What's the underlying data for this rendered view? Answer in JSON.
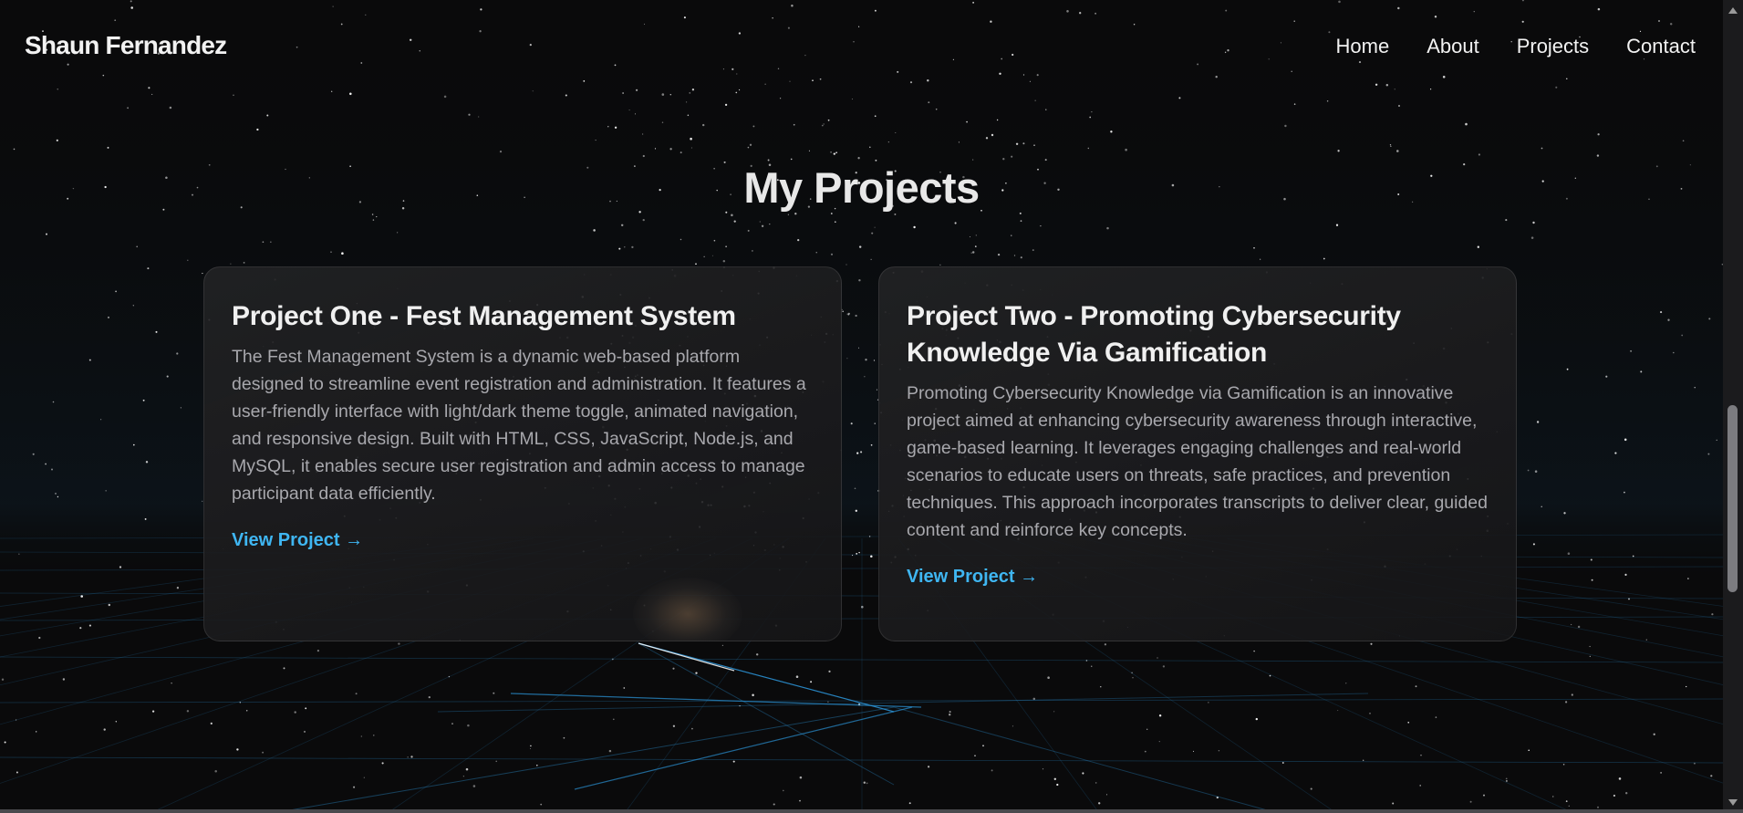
{
  "brand": {
    "name": "Shaun Fernandez"
  },
  "nav": {
    "items": [
      {
        "label": "Home"
      },
      {
        "label": "About"
      },
      {
        "label": "Projects"
      },
      {
        "label": "Contact"
      }
    ]
  },
  "projects": {
    "heading": "My Projects",
    "cards": [
      {
        "title": "Project One - Fest Management System",
        "description": "The Fest Management System is a dynamic web-based platform designed to streamline event registration and administration. It features a user-friendly interface with light/dark theme toggle, animated navigation, and responsive design. Built with HTML, CSS, JavaScript, Node.js, and MySQL, it enables secure user registration and admin access to manage participant data efficiently.",
        "link_label": "View Project →"
      },
      {
        "title": "Project Two - Promoting Cybersecurity Knowledge Via Gamification",
        "description": "Promoting Cybersecurity Knowledge via Gamification is an innovative project aimed at enhancing cybersecurity awareness through interactive, game-based learning. It leverages engaging challenges and real-world scenarios to educate users on threats, safe practices, and prevention techniques. This approach incorporates transcripts to deliver clear, guided content and reinforce key concepts.",
        "link_label": "View Project →"
      }
    ]
  },
  "colors": {
    "background": "#0a0a0b",
    "accent": "#3fb6f2",
    "grid_line": "#2a8fd0"
  },
  "icons": {
    "scroll_up": "chevron-up-icon",
    "scroll_down": "chevron-down-icon"
  }
}
